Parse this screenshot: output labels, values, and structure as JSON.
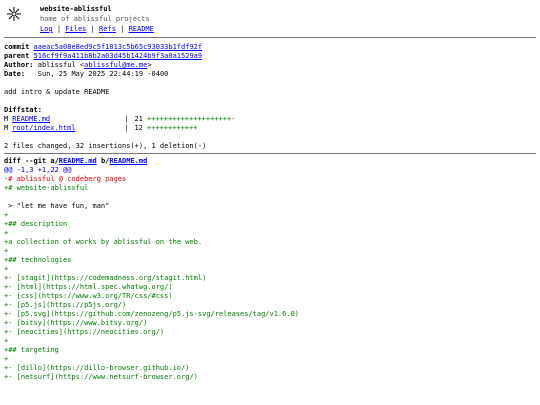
{
  "repo": {
    "name": "website-ablissful",
    "description": "home of ablissful projects",
    "logo_icon": "flower-icon"
  },
  "nav": {
    "log": "Log",
    "files": "Files",
    "refs": "Refs",
    "readme": "README",
    "separator": " | "
  },
  "commit": {
    "commit_label": "commit",
    "commit_hash": "aaeac5a08e8ed9c5f1013c5b65c93033b1fdf92f",
    "parent_label": "parent",
    "parent_hash": "516cf9f9a411b8b2a03d45b1424b9f3a0a1529a9",
    "author_label": "Author:",
    "author_name": "ablissful",
    "author_email": "ablissful@me.me",
    "date_label": "Date:",
    "date_value": "Sun, 25 May 2025 22:44:19 -0400",
    "message": "add intro & update README"
  },
  "diffstat": {
    "title": "Diffstat:",
    "files": [
      {
        "mode": "M",
        "path": "README.md",
        "count": "21",
        "plus": "++++++++++++++++++++",
        "minus": "-"
      },
      {
        "mode": "M",
        "path": "root/index.html",
        "count": "12",
        "plus": "++++++++++++",
        "minus": ""
      }
    ],
    "summary": "2 files changed, 32 insertions(+), 1 deletion(-)"
  },
  "diff": {
    "header_prefix": "diff --git a/",
    "file_a": "README.md",
    "header_mid": " b/",
    "file_b": "README.md",
    "hunk": "@@ -1,3 +1,22 @@",
    "lines": [
      {
        "type": "del",
        "text": "-# ablissful @ codeberg pages"
      },
      {
        "type": "add",
        "text": "+# website-ablissful"
      },
      {
        "type": "ctx",
        "text": " "
      },
      {
        "type": "ctx",
        "text": " > \"let me have fun, man\""
      },
      {
        "type": "add",
        "text": "+"
      },
      {
        "type": "add",
        "text": "+## description"
      },
      {
        "type": "add",
        "text": "+"
      },
      {
        "type": "add",
        "text": "+a collection of works by ablissful on the web."
      },
      {
        "type": "add",
        "text": "+"
      },
      {
        "type": "add",
        "text": "+## technologies"
      },
      {
        "type": "add",
        "text": "+"
      },
      {
        "type": "add",
        "text": "+- [stagit](https://codemadness.org/stagit.html)"
      },
      {
        "type": "add",
        "text": "+- [html](https://html.spec.whatwg.org/)"
      },
      {
        "type": "add",
        "text": "+- [css](https://www.w3.org/TR/css/#css)"
      },
      {
        "type": "add",
        "text": "+- [p5.js](https://p5js.org/)"
      },
      {
        "type": "add",
        "text": "+- [p5.svg](https://github.com/zenozeng/p5.js-svg/releases/tag/v1.6.0)"
      },
      {
        "type": "add",
        "text": "+- [bitsy](https://www.bitsy.org/)"
      },
      {
        "type": "add",
        "text": "+- [neocities](https://neocities.org/)"
      },
      {
        "type": "add",
        "text": "+"
      },
      {
        "type": "add",
        "text": "+## targeting"
      },
      {
        "type": "add",
        "text": "+"
      },
      {
        "type": "add",
        "text": "+- [dillo](https://dillo-browser.github.io/)"
      },
      {
        "type": "add",
        "text": "+- [netsurf](https://www.netsurf-browser.org/)"
      }
    ]
  },
  "colors": {
    "addition": "#008000",
    "deletion": "#e00000",
    "hunk": "#0000cc",
    "link": "#0000ee"
  }
}
